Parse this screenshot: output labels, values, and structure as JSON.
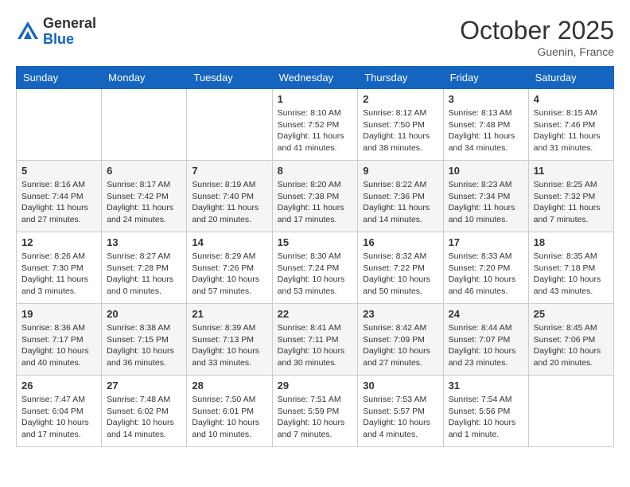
{
  "header": {
    "logo_general": "General",
    "logo_blue": "Blue",
    "month_title": "October 2025",
    "location": "Guenin, France"
  },
  "days_of_week": [
    "Sunday",
    "Monday",
    "Tuesday",
    "Wednesday",
    "Thursday",
    "Friday",
    "Saturday"
  ],
  "weeks": [
    [
      {
        "day": "",
        "detail": ""
      },
      {
        "day": "",
        "detail": ""
      },
      {
        "day": "",
        "detail": ""
      },
      {
        "day": "1",
        "detail": "Sunrise: 8:10 AM\nSunset: 7:52 PM\nDaylight: 11 hours\nand 41 minutes."
      },
      {
        "day": "2",
        "detail": "Sunrise: 8:12 AM\nSunset: 7:50 PM\nDaylight: 11 hours\nand 38 minutes."
      },
      {
        "day": "3",
        "detail": "Sunrise: 8:13 AM\nSunset: 7:48 PM\nDaylight: 11 hours\nand 34 minutes."
      },
      {
        "day": "4",
        "detail": "Sunrise: 8:15 AM\nSunset: 7:46 PM\nDaylight: 11 hours\nand 31 minutes."
      }
    ],
    [
      {
        "day": "5",
        "detail": "Sunrise: 8:16 AM\nSunset: 7:44 PM\nDaylight: 11 hours\nand 27 minutes."
      },
      {
        "day": "6",
        "detail": "Sunrise: 8:17 AM\nSunset: 7:42 PM\nDaylight: 11 hours\nand 24 minutes."
      },
      {
        "day": "7",
        "detail": "Sunrise: 8:19 AM\nSunset: 7:40 PM\nDaylight: 11 hours\nand 20 minutes."
      },
      {
        "day": "8",
        "detail": "Sunrise: 8:20 AM\nSunset: 7:38 PM\nDaylight: 11 hours\nand 17 minutes."
      },
      {
        "day": "9",
        "detail": "Sunrise: 8:22 AM\nSunset: 7:36 PM\nDaylight: 11 hours\nand 14 minutes."
      },
      {
        "day": "10",
        "detail": "Sunrise: 8:23 AM\nSunset: 7:34 PM\nDaylight: 11 hours\nand 10 minutes."
      },
      {
        "day": "11",
        "detail": "Sunrise: 8:25 AM\nSunset: 7:32 PM\nDaylight: 11 hours\nand 7 minutes."
      }
    ],
    [
      {
        "day": "12",
        "detail": "Sunrise: 8:26 AM\nSunset: 7:30 PM\nDaylight: 11 hours\nand 3 minutes."
      },
      {
        "day": "13",
        "detail": "Sunrise: 8:27 AM\nSunset: 7:28 PM\nDaylight: 11 hours\nand 0 minutes."
      },
      {
        "day": "14",
        "detail": "Sunrise: 8:29 AM\nSunset: 7:26 PM\nDaylight: 10 hours\nand 57 minutes."
      },
      {
        "day": "15",
        "detail": "Sunrise: 8:30 AM\nSunset: 7:24 PM\nDaylight: 10 hours\nand 53 minutes."
      },
      {
        "day": "16",
        "detail": "Sunrise: 8:32 AM\nSunset: 7:22 PM\nDaylight: 10 hours\nand 50 minutes."
      },
      {
        "day": "17",
        "detail": "Sunrise: 8:33 AM\nSunset: 7:20 PM\nDaylight: 10 hours\nand 46 minutes."
      },
      {
        "day": "18",
        "detail": "Sunrise: 8:35 AM\nSunset: 7:18 PM\nDaylight: 10 hours\nand 43 minutes."
      }
    ],
    [
      {
        "day": "19",
        "detail": "Sunrise: 8:36 AM\nSunset: 7:17 PM\nDaylight: 10 hours\nand 40 minutes."
      },
      {
        "day": "20",
        "detail": "Sunrise: 8:38 AM\nSunset: 7:15 PM\nDaylight: 10 hours\nand 36 minutes."
      },
      {
        "day": "21",
        "detail": "Sunrise: 8:39 AM\nSunset: 7:13 PM\nDaylight: 10 hours\nand 33 minutes."
      },
      {
        "day": "22",
        "detail": "Sunrise: 8:41 AM\nSunset: 7:11 PM\nDaylight: 10 hours\nand 30 minutes."
      },
      {
        "day": "23",
        "detail": "Sunrise: 8:42 AM\nSunset: 7:09 PM\nDaylight: 10 hours\nand 27 minutes."
      },
      {
        "day": "24",
        "detail": "Sunrise: 8:44 AM\nSunset: 7:07 PM\nDaylight: 10 hours\nand 23 minutes."
      },
      {
        "day": "25",
        "detail": "Sunrise: 8:45 AM\nSunset: 7:06 PM\nDaylight: 10 hours\nand 20 minutes."
      }
    ],
    [
      {
        "day": "26",
        "detail": "Sunrise: 7:47 AM\nSunset: 6:04 PM\nDaylight: 10 hours\nand 17 minutes."
      },
      {
        "day": "27",
        "detail": "Sunrise: 7:48 AM\nSunset: 6:02 PM\nDaylight: 10 hours\nand 14 minutes."
      },
      {
        "day": "28",
        "detail": "Sunrise: 7:50 AM\nSunset: 6:01 PM\nDaylight: 10 hours\nand 10 minutes."
      },
      {
        "day": "29",
        "detail": "Sunrise: 7:51 AM\nSunset: 5:59 PM\nDaylight: 10 hours\nand 7 minutes."
      },
      {
        "day": "30",
        "detail": "Sunrise: 7:53 AM\nSunset: 5:57 PM\nDaylight: 10 hours\nand 4 minutes."
      },
      {
        "day": "31",
        "detail": "Sunrise: 7:54 AM\nSunset: 5:56 PM\nDaylight: 10 hours\nand 1 minute."
      },
      {
        "day": "",
        "detail": ""
      }
    ]
  ]
}
